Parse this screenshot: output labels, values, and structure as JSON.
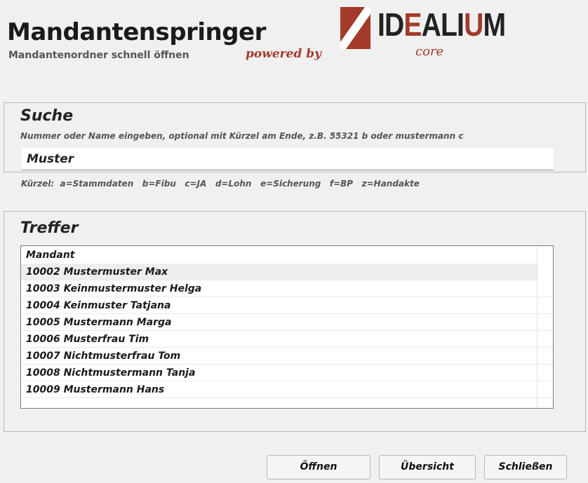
{
  "header": {
    "title": "Mandantenspringer",
    "subtitle": "Mandantenordner schnell öffnen",
    "powered_by": "powered by",
    "logo_left": "ID",
    "logo_accent": "E",
    "logo_mid": "ALI",
    "logo_accent2": "U",
    "logo_right": "M",
    "logo_sub": "core",
    "brand_color": "#a33a2a"
  },
  "search": {
    "title": "Suche",
    "hint": "Nummer oder Name eingeben, optional mit Kürzel am Ende, z.B. 55321 b oder mustermann c",
    "value": "Muster",
    "kuerzel": "Kürzel:  a=Stammdaten   b=Fibu   c=JA   d=Lohn   e=Sicherung   f=BP   z=Handakte"
  },
  "results": {
    "title": "Treffer",
    "column": "Mandant",
    "rows": [
      "10002 Mustermuster Max",
      "10003 Keinmustermuster Helga",
      "10004 Keinmuster Tatjana",
      "10005 Mustermann Marga",
      "10006 Musterfrau Tim",
      "10007 Nichtmusterfrau Tom",
      "10008 Nichtmustermann Tanja",
      "10009 Mustermann Hans"
    ]
  },
  "buttons": {
    "open": "Öffnen",
    "overview": "Übersicht",
    "close": "Schließen"
  }
}
